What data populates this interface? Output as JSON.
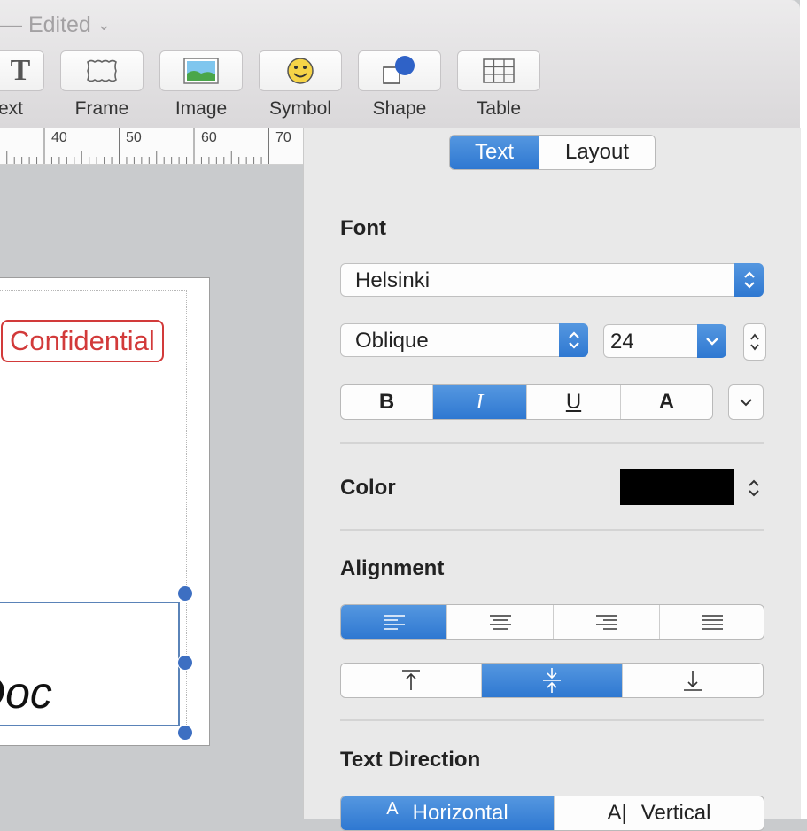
{
  "window": {
    "title": "— Edited",
    "title_chevron": "⌄"
  },
  "toolbar": {
    "items": [
      {
        "label": "ext",
        "icon": "text-icon"
      },
      {
        "label": "Frame",
        "icon": "frame-icon"
      },
      {
        "label": "Image",
        "icon": "image-icon"
      },
      {
        "label": "Symbol",
        "icon": "symbol-icon"
      },
      {
        "label": "Shape",
        "icon": "shape-icon"
      },
      {
        "label": "Table",
        "icon": "table-icon"
      }
    ],
    "text_glyph": "T"
  },
  "ruler": {
    "labels": [
      "40",
      "50",
      "60",
      "70"
    ]
  },
  "canvas": {
    "stamp_text": "Confidential",
    "body_text": "Doc"
  },
  "inspector": {
    "tabs": [
      {
        "label": "Text",
        "active": true
      },
      {
        "label": "Layout",
        "active": false
      }
    ],
    "font": {
      "heading": "Font",
      "family": "Helsinki",
      "typeface": "Oblique",
      "size": "24",
      "styles": [
        {
          "label": "B",
          "active": false
        },
        {
          "label": "I",
          "active": true
        },
        {
          "label": "U",
          "active": false
        },
        {
          "label": "A",
          "active": false
        }
      ]
    },
    "color": {
      "heading": "Color",
      "value": "#000000"
    },
    "alignment": {
      "heading": "Alignment",
      "horizontal_active": 0,
      "vertical_active": 1
    },
    "text_direction": {
      "heading": "Text Direction",
      "options": [
        {
          "label": "Horizontal",
          "glyph": "A",
          "active": true
        },
        {
          "label": "Vertical",
          "glyph": "A|",
          "active": false
        }
      ]
    }
  },
  "colors": {
    "accent": "#3a7fd5",
    "stamp": "#d23a3a",
    "selection": "#5a83b8"
  }
}
